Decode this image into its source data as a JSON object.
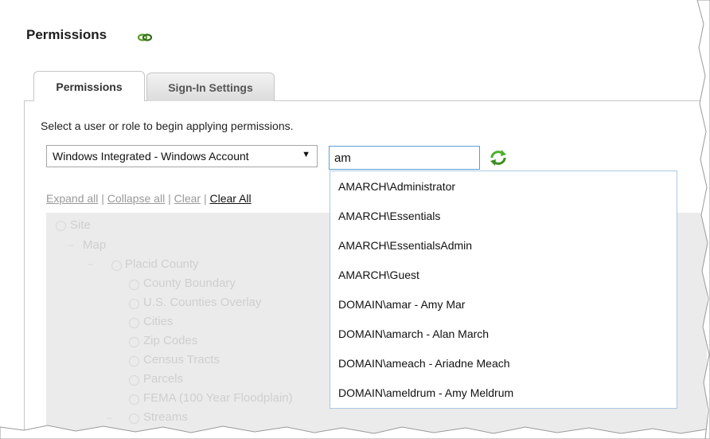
{
  "page": {
    "title": "Permissions"
  },
  "tabs": [
    {
      "label": "Permissions",
      "active": true
    },
    {
      "label": "Sign-In Settings",
      "active": false
    }
  ],
  "instruction": "Select a user or role to begin applying permissions.",
  "auth_select": {
    "selected": "Windows Integrated - Windows Account"
  },
  "search": {
    "value": "am"
  },
  "tree_links": {
    "expand_all": "Expand all",
    "collapse_all": "Collapse all",
    "clear": "Clear",
    "clear_all": "Clear All",
    "separator": "|"
  },
  "tree": {
    "site": "Site",
    "map": "Map",
    "county": "Placid County",
    "layers": [
      "County Boundary",
      "U.S. Counties Overlay",
      "Cities",
      "Zip Codes",
      "Census Tracts",
      "Parcels",
      "FEMA (100 Year Floodplain)",
      "Streams"
    ]
  },
  "suggestions": [
    "AMARCH\\Administrator",
    "AMARCH\\Essentials",
    "AMARCH\\EssentialsAdmin",
    "AMARCH\\Guest",
    "DOMAIN\\amar - Amy Mar",
    "DOMAIN\\amarch - Alan March",
    "DOMAIN\\ameach - Ariadne Meach",
    "DOMAIN\\ameldrum - Amy Meldrum"
  ],
  "icons": {
    "title_icon": "link-chain-icon",
    "refresh_icon": "refresh-icon",
    "dropdown_arrow": "dropdown-arrow-icon"
  },
  "colors": {
    "input_border": "#5aa0d8",
    "refresh_green": "#4caf2a",
    "tree_background": "#ebebeb"
  }
}
